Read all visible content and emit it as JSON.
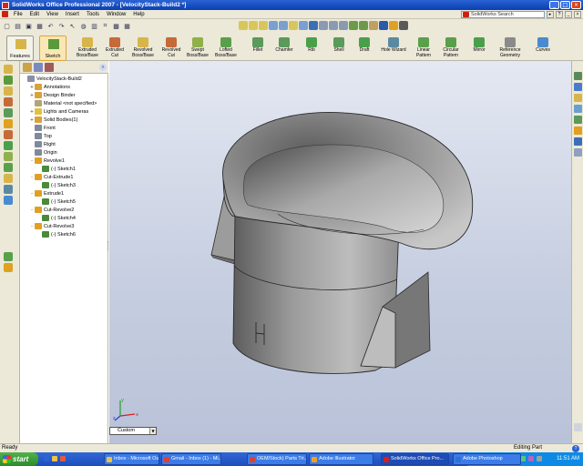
{
  "window": {
    "title": "SolidWorks Office Professional 2007 - [VelocityStack-Build2 *]",
    "buttons": [
      "_",
      "□",
      "×"
    ]
  },
  "menu": {
    "items": [
      "File",
      "Edit",
      "View",
      "Insert",
      "Tools",
      "Window",
      "Help"
    ],
    "search_placeholder": "SolidWorks Search"
  },
  "command_manager": {
    "features_tab": "Features",
    "sketch_tab": "Sketch",
    "commands": [
      {
        "label": "Extruded\nBoss/Base"
      },
      {
        "label": "Extruded\nCut"
      },
      {
        "label": "Revolved\nBoss/Base"
      },
      {
        "label": "Revolved\nCut"
      },
      {
        "label": "Swept\nBoss/Base"
      },
      {
        "label": "Lofted\nBoss/Base"
      },
      {
        "label": "Fillet"
      },
      {
        "label": "Chamfer"
      },
      {
        "label": "Rib"
      },
      {
        "label": "Shell"
      },
      {
        "label": "Draft"
      },
      {
        "label": "Hole Wizard"
      },
      {
        "label": "Linear\nPattern"
      },
      {
        "label": "Circular\nPattern"
      },
      {
        "label": "Mirror"
      },
      {
        "label": "Reference\nGeometry"
      },
      {
        "label": "Curves"
      }
    ]
  },
  "feature_tree": {
    "items": [
      {
        "label": "VelocityStack-Build2",
        "level": 0,
        "exp": "",
        "color": "#8a8fa6"
      },
      {
        "label": "Annotations",
        "level": 1,
        "exp": "+",
        "color": "#d9a23a"
      },
      {
        "label": "Design Binder",
        "level": 1,
        "exp": "+",
        "color": "#d9a23a"
      },
      {
        "label": "Material <not specified>",
        "level": 1,
        "exp": "",
        "color": "#b2a57a"
      },
      {
        "label": "Lights and Cameras",
        "level": 1,
        "exp": "+",
        "color": "#e1c23c"
      },
      {
        "label": "Solid Bodies(1)",
        "level": 1,
        "exp": "+",
        "color": "#d9a23a"
      },
      {
        "label": "Front",
        "level": 1,
        "exp": "",
        "color": "#7f8a9a"
      },
      {
        "label": "Top",
        "level": 1,
        "exp": "",
        "color": "#7f8a9a"
      },
      {
        "label": "Right",
        "level": 1,
        "exp": "",
        "color": "#7f8a9a"
      },
      {
        "label": "Origin",
        "level": 1,
        "exp": "",
        "color": "#7f8a9a"
      },
      {
        "label": "Revolve1",
        "level": 1,
        "exp": "-",
        "color": "#e0a020"
      },
      {
        "label": "(-) Sketch1",
        "level": 2,
        "exp": "",
        "color": "#4a8a3a"
      },
      {
        "label": "Cut-Extrude1",
        "level": 1,
        "exp": "-",
        "color": "#e0a020"
      },
      {
        "label": "(-) Sketch3",
        "level": 2,
        "exp": "",
        "color": "#4a8a3a"
      },
      {
        "label": "Extrude1",
        "level": 1,
        "exp": "-",
        "color": "#e0a020"
      },
      {
        "label": "(-) Sketch5",
        "level": 2,
        "exp": "",
        "color": "#4a8a3a"
      },
      {
        "label": "Cut-Revolve2",
        "level": 1,
        "exp": "-",
        "color": "#e0a020"
      },
      {
        "label": "(-) Sketch4",
        "level": 2,
        "exp": "",
        "color": "#4a8a3a"
      },
      {
        "label": "Cut-Revolve3",
        "level": 1,
        "exp": "-",
        "color": "#e0a020"
      },
      {
        "label": "(-) Sketch6",
        "level": 2,
        "exp": "",
        "color": "#4a8a3a"
      }
    ]
  },
  "viewport": {
    "view_orientation": "Custom",
    "triad_axes": [
      "x",
      "y",
      "z"
    ]
  },
  "status": {
    "left": "Ready",
    "mode": "Editing Part",
    "help_icon": "?"
  },
  "taskbar": {
    "start_label": "start",
    "tasks": [
      {
        "label": "Inbox - Microsoft Out...",
        "color": "#f0c040"
      },
      {
        "label": "Gmail - Inbox (1) - Mi...",
        "color": "#e04030"
      },
      {
        "label": "OEM/Stock) Parts Tri...",
        "color": "#e04030"
      },
      {
        "label": "Adobe Illustrator",
        "color": "#f0a020"
      },
      {
        "label": "SolidWorks Office Pro...",
        "color": "#d02020"
      },
      {
        "label": "Adobe Photoshop",
        "color": "#3070d0"
      }
    ],
    "clock": "11:51 AM"
  },
  "colors": {
    "title_bar": "#0a3fb0",
    "chrome": "#ece9d8",
    "viewport_top": "#e4e8f2",
    "viewport_bottom": "#b9c2d8",
    "part_dark": "#6c6c6c",
    "part_light": "#c9c9c9"
  }
}
